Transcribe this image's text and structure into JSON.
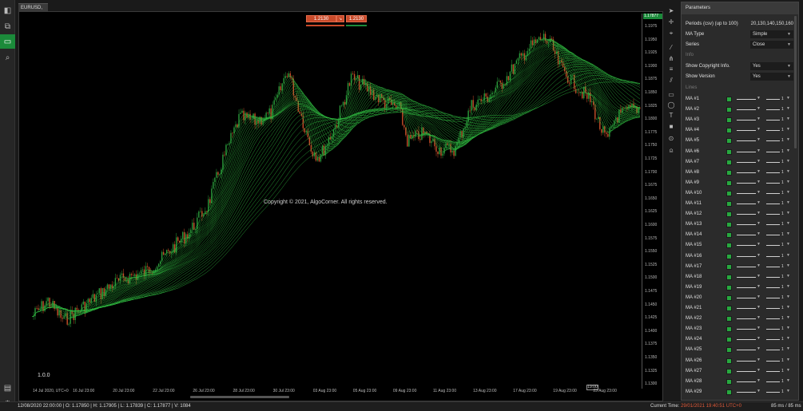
{
  "chart_tab": "EURUSD, h1",
  "trade": {
    "sell_price": "1.2130",
    "sell_marker": "↘",
    "buy_marker": "↘",
    "buy_price": "1.2130"
  },
  "copyright": "Copyright © 2021, AlgoCorner. All rights reserved.",
  "version": "1.0.0",
  "price_tag": "1.17877",
  "price_labels": [
    "1.1975",
    "1.1950",
    "1.1925",
    "1.1900",
    "1.1875",
    "1.1850",
    "1.1825",
    "1.1800",
    "1.1775",
    "1.1750",
    "1.1725",
    "1.1700",
    "1.1675",
    "1.1650",
    "1.1625",
    "1.1600",
    "1.1575",
    "1.1550",
    "1.1525",
    "1.1500",
    "1.1475",
    "1.1450",
    "1.1425",
    "1.1400",
    "1.1375",
    "1.1350",
    "1.1325",
    "1.1300"
  ],
  "time_labels": [
    "14 Jul 2020, UTC+0",
    "16 Jul 23:00",
    "20 Jul 23:00",
    "22 Jul 23:00",
    "26 Jul 23:00",
    "28 Jul 23:00",
    "30 Jul 23:00",
    "03 Aug 23:00",
    "05 Aug 23:00",
    "09 Aug 23:00",
    "11 Aug 23:00",
    "13 Aug 23:00",
    "17 Aug 23:00",
    "19 Aug 23:00",
    "23 Aug 23:00"
  ],
  "time_tag": "19:00",
  "panel": {
    "title": "Parameters",
    "periods_label": "Periods (csv) (up to 100)",
    "periods_value": "20,130,140,150,160",
    "ma_type_label": "MA Type",
    "ma_type_value": "Simple",
    "series_label": "Series",
    "series_value": "Close",
    "info_section": "Info",
    "show_copyright_label": "Show Copyright Info.",
    "show_copyright_value": "Yes",
    "show_version_label": "Show Version",
    "show_version_value": "Yes",
    "lines_section": "Lines",
    "ma_lines": [
      "MA #1",
      "MA #2",
      "MA #3",
      "MA #4",
      "MA #5",
      "MA #6",
      "MA #7",
      "MA #8",
      "MA #9",
      "MA #10",
      "MA #11",
      "MA #12",
      "MA #13",
      "MA #14",
      "MA #15",
      "MA #16",
      "MA #17",
      "MA #18",
      "MA #19",
      "MA #20",
      "MA #21",
      "MA #22",
      "MA #23",
      "MA #24",
      "MA #25",
      "MA #26",
      "MA #27",
      "MA #28",
      "MA #29"
    ],
    "ma_width": "1",
    "ma_color": "#27a83f"
  },
  "status": {
    "ohlc": "12/08/2020 22:00:00 | O: 1.17850 | H: 1.17905 | L: 1.17839 | C: 1.17877 | V: 1084",
    "current_time_label": "Current Time:",
    "current_time": "29/01/2021 19:40:51",
    "timezone": "UTC+0",
    "latency": "85 ms / 85 ms"
  },
  "colors": {
    "accent": "#1b8a3a",
    "sell": "#c94a2a",
    "ma_line": "#2fb83f"
  }
}
